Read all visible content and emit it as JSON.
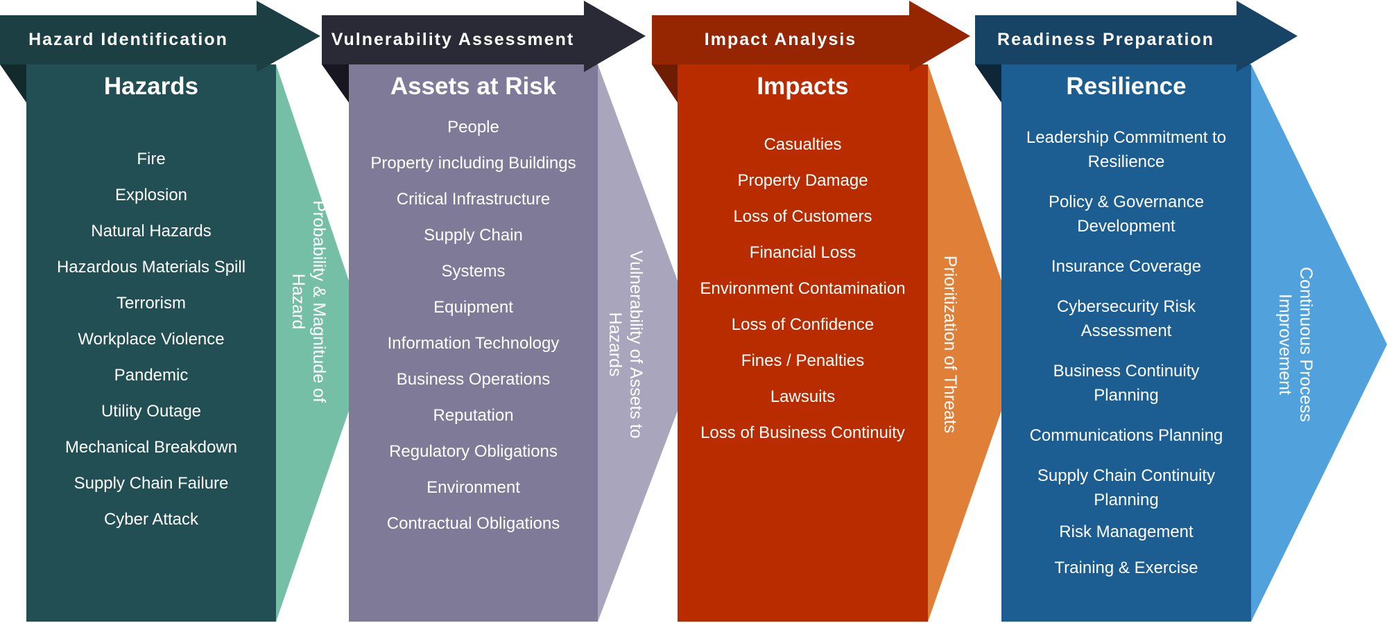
{
  "diagram": {
    "stages": [
      {
        "header": "Hazard Identification",
        "title": "Hazards",
        "items": [
          "Fire",
          "Explosion",
          "Natural Hazards",
          "Hazardous Materials Spill",
          "Terrorism",
          "Workplace Violence",
          "Pandemic",
          "Utility Outage",
          "Mechanical Breakdown",
          "Supply Chain Failure",
          "Cyber Attack"
        ],
        "side_label": "Probability & Magnitude of Hazard",
        "colors": {
          "header": "#1b3f42",
          "fold": "#122a2c",
          "body": "#214f53",
          "side": "#76bfa7"
        }
      },
      {
        "header": "Vulnerability Assessment",
        "title": "Assets at Risk",
        "items": [
          "People",
          "Property including Buildings",
          "Critical Infrastructure",
          "Supply Chain",
          "Systems",
          "Equipment",
          "Information Technology",
          "Business Operations",
          "Reputation",
          "Regulatory Obligations",
          "Environment",
          "Contractual Obligations"
        ],
        "side_label": "Vulnerability of Assets to Hazards",
        "colors": {
          "header": "#2a2936",
          "fold": "#181721",
          "body": "#7e7a98",
          "side": "#a8a5bd"
        }
      },
      {
        "header": "Impact Analysis",
        "title": "Impacts",
        "items": [
          "Casualties",
          "Property Damage",
          "Loss of Customers",
          "Financial Loss",
          "Environment Contamination",
          "Loss of Confidence",
          "Fines / Penalties",
          "Lawsuits",
          "Loss of Business Continuity"
        ],
        "side_label": "Prioritization of Threats",
        "colors": {
          "header": "#962501",
          "fold": "#6e1c02",
          "body": "#b82c00",
          "side": "#df7f38"
        }
      },
      {
        "header": "Readiness Preparation",
        "title": "Resilience",
        "items": [
          "Leadership Commitment to Resilience",
          "Policy & Governance Development",
          "Insurance Coverage",
          "Cybersecurity Risk Assessment",
          "Business Continuity Planning",
          "Communications Planning",
          "Supply Chain Continuity Planning",
          "Risk Management",
          "Training & Exercise"
        ],
        "side_label": "Continuous Process Improvement",
        "colors": {
          "header": "#174465",
          "fold": "#0f2639",
          "body": "#1d5e92",
          "side": "#51a1dd"
        }
      }
    ]
  }
}
